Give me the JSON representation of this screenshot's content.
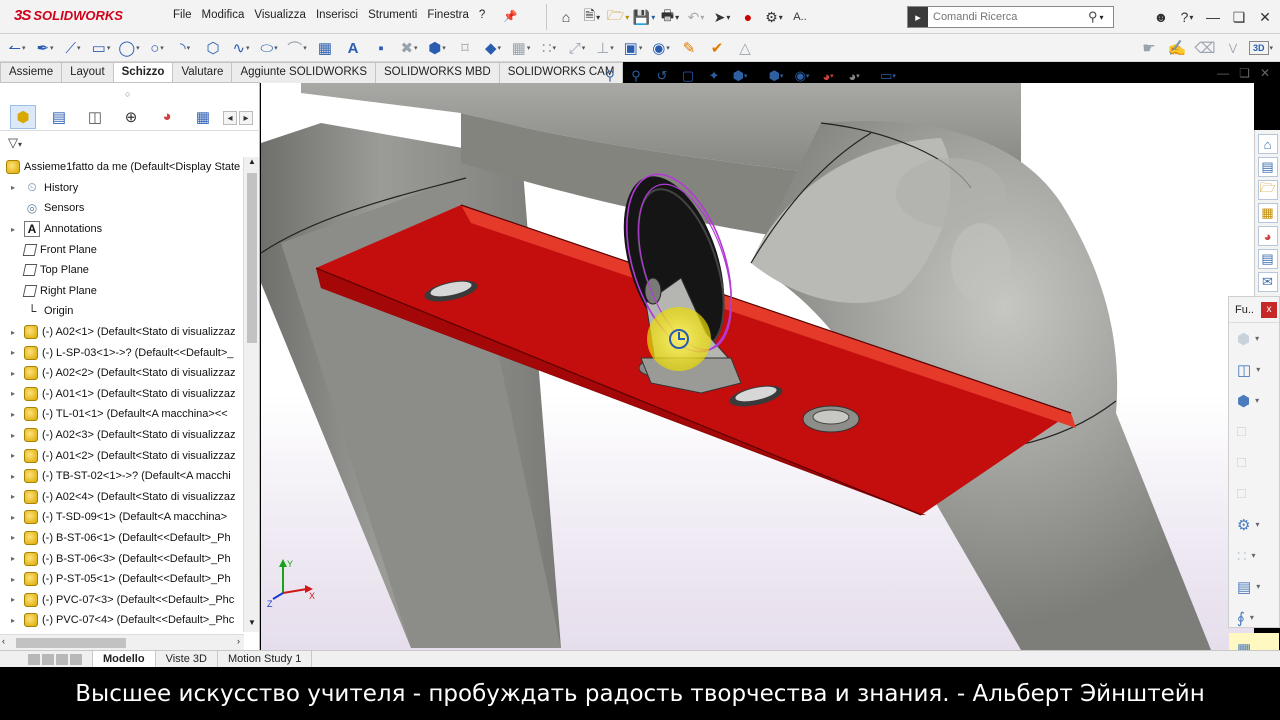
{
  "app": {
    "brand_ds": "3S",
    "brand_name": "SOLIDWORKS"
  },
  "menu": [
    "File",
    "Modifica",
    "Visualizza",
    "Inserisci",
    "Strumenti",
    "Finestra",
    "?"
  ],
  "menu_extra": "A..",
  "search": {
    "placeholder": "Comandi Ricerca"
  },
  "tabs": [
    "Assieme",
    "Layout",
    "Schizzo",
    "Valutare",
    "Aggiunte SOLIDWORKS",
    "SOLIDWORKS MBD",
    "SOLIDWORKS CAM"
  ],
  "active_tab": "Schizzo",
  "tree": {
    "root": "Assieme1fatto da me  (Default<Display State",
    "items": [
      {
        "label": "History",
        "icon": "history-icon",
        "expandable": true
      },
      {
        "label": "Sensors",
        "icon": "sensors-icon",
        "expandable": false
      },
      {
        "label": "Annotations",
        "icon": "annotations-icon",
        "expandable": true
      },
      {
        "label": "Front Plane",
        "icon": "plane-icon",
        "expandable": false
      },
      {
        "label": "Top Plane",
        "icon": "plane-icon",
        "expandable": false
      },
      {
        "label": "Right Plane",
        "icon": "plane-icon",
        "expandable": false
      },
      {
        "label": "Origin",
        "icon": "origin-icon",
        "expandable": false
      },
      {
        "label": "(-) A02<1> (Default<Stato di visualizzaz",
        "icon": "part-icon",
        "expandable": true
      },
      {
        "label": "(-) L-SP-03<1>->? (Default<<Default>_",
        "icon": "part-icon",
        "expandable": true
      },
      {
        "label": "(-) A02<2> (Default<Stato di visualizzaz",
        "icon": "part-icon",
        "expandable": true
      },
      {
        "label": "(-) A01<1> (Default<Stato di visualizzaz",
        "icon": "part-icon",
        "expandable": true
      },
      {
        "label": "(-) TL-01<1> (Default<A macchina><<",
        "icon": "part-icon",
        "expandable": true
      },
      {
        "label": "(-) A02<3> (Default<Stato di visualizzaz",
        "icon": "part-icon",
        "expandable": true
      },
      {
        "label": "(-) A01<2> (Default<Stato di visualizzaz",
        "icon": "part-icon",
        "expandable": true
      },
      {
        "label": "(-) TB-ST-02<1>->? (Default<A macchi",
        "icon": "part-icon",
        "expandable": true
      },
      {
        "label": "(-) A02<4> (Default<Stato di visualizzaz",
        "icon": "part-icon",
        "expandable": true
      },
      {
        "label": "(-) T-SD-09<1> (Default<A macchina>",
        "icon": "part-icon",
        "expandable": true
      },
      {
        "label": "(-) B-ST-06<1> (Default<<Default>_Ph",
        "icon": "part-icon",
        "expandable": true
      },
      {
        "label": "(-) B-ST-06<3> (Default<<Default>_Ph",
        "icon": "part-icon",
        "expandable": true
      },
      {
        "label": "(-) P-ST-05<1> (Default<<Default>_Ph",
        "icon": "part-icon",
        "expandable": true
      },
      {
        "label": "(-) PVC-07<3> (Default<<Default>_Phc",
        "icon": "part-icon",
        "expandable": true
      },
      {
        "label": "(-) PVC-07<4> (Default<<Default>_Phc",
        "icon": "part-icon",
        "expandable": true
      }
    ]
  },
  "bottom_tabs": [
    "Modello",
    "Viste 3D",
    "Motion Study 1"
  ],
  "active_bottom_tab": "Modello",
  "hud_panel": {
    "title": "Fu..",
    "close": "x"
  },
  "toolbar_right_badge": "3D",
  "triad": {
    "x": "X",
    "y": "Y",
    "z": "Z"
  },
  "subtitle": "Высшее искусство учителя - пробуждать радость творчества и знания. - Альберт Эйнштейн",
  "colors": {
    "brand_red": "#d0021b",
    "channel_red": "#c40d0d",
    "tube_gray": "#8a8a86",
    "selection_magenta": "#b23bd6"
  }
}
